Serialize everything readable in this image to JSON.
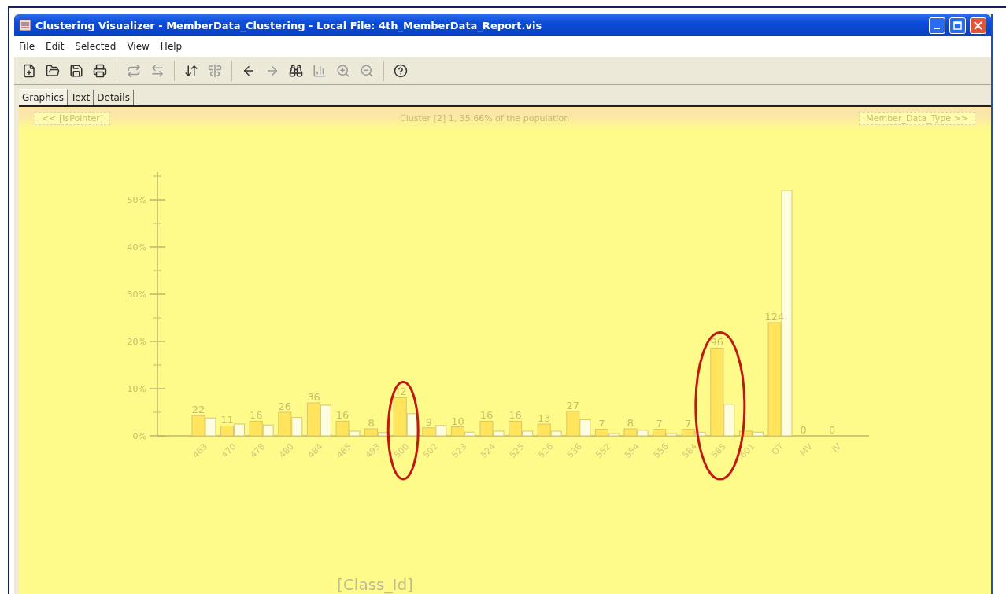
{
  "window": {
    "title": "Clustering Visualizer - MemberData_Clustering - Local File: 4th_MemberData_Report.vis"
  },
  "menu": [
    "File",
    "Edit",
    "Selected",
    "View",
    "Help"
  ],
  "tabs": [
    {
      "label": "Graphics",
      "selected": true
    },
    {
      "label": "Text",
      "selected": false
    },
    {
      "label": "Details",
      "selected": false
    }
  ],
  "graphics": {
    "prev_button": "<< [IsPointer]",
    "title": "Cluster [2] 1, 35.66% of the population",
    "next_button": "Member_Data_Type >>",
    "circled_bars": [
      {
        "circled": false
      },
      {
        "circled": false
      },
      {
        "circled": false
      },
      {
        "circled": false
      },
      {
        "circled": false
      },
      {
        "circled": false
      },
      {
        "circled": false
      },
      {
        "circled": true
      },
      {
        "circled": false
      },
      {
        "circled": false
      },
      {
        "circled": false
      },
      {
        "circled": false
      },
      {
        "circled": false
      },
      {
        "circled": false
      },
      {
        "circled": false
      },
      {
        "circled": false
      },
      {
        "circled": false
      },
      {
        "circled": false
      },
      {
        "circled": true
      },
      {
        "circled": false
      },
      {
        "circled": false
      },
      {
        "circled": false
      },
      {
        "circled": false
      }
    ],
    "axis_title": "[Class_Id]",
    "chart_data": {
      "type": "bar",
      "categories": [
        "463",
        "470",
        "478",
        "480",
        "484",
        "485",
        "493",
        "500",
        "502",
        "523",
        "524",
        "525",
        "526",
        "536",
        "552",
        "554",
        "556",
        "584",
        "585",
        "601",
        "OT",
        "MV",
        "IV"
      ],
      "series": [
        {
          "color": "#ffe45c",
          "values": [
            4.3,
            2.1,
            3.1,
            5.0,
            7.0,
            3.1,
            1.5,
            8.1,
            1.7,
            1.9,
            3.1,
            3.1,
            2.5,
            5.2,
            1.4,
            1.5,
            1.4,
            1.4,
            18.6,
            1.0,
            24.0,
            0,
            0
          ]
        },
        {
          "color": "#fffde0",
          "values": [
            3.8,
            2.5,
            2.3,
            3.9,
            6.5,
            1.0,
            0.7,
            4.7,
            2.2,
            0.8,
            1.0,
            1.0,
            1.0,
            3.4,
            0.5,
            1.2,
            0.5,
            0.8,
            6.7,
            0.8,
            52.0,
            0,
            0
          ]
        }
      ],
      "value_labels": [
        "22",
        "11",
        "16",
        "26",
        "36",
        "16",
        "8",
        "42",
        "9",
        "10",
        "16",
        "16",
        "13",
        "27",
        "7",
        "8",
        "7",
        "7",
        "96",
        null,
        "124",
        "0",
        "0"
      ],
      "ylim": [
        0,
        56
      ],
      "yticks": [
        {
          "value": 0,
          "label": "0%"
        },
        {
          "value": 10,
          "label": "10%"
        },
        {
          "value": 20,
          "label": "20%"
        },
        {
          "value": 30,
          "label": "30%"
        },
        {
          "value": 40,
          "label": "40%"
        },
        {
          "value": 50,
          "label": "50%"
        }
      ]
    }
  }
}
